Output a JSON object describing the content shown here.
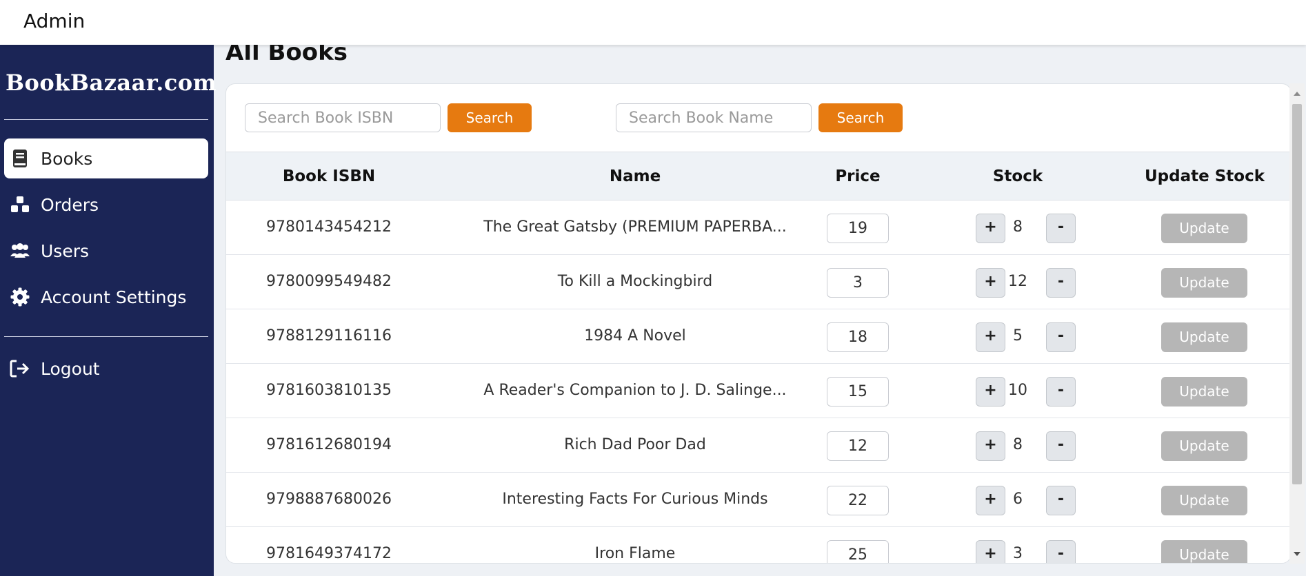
{
  "header": {
    "title": "Admin"
  },
  "sidebar": {
    "brand": "BookBazaar.com",
    "items": [
      {
        "label": "Books",
        "icon": "book-icon",
        "active": true
      },
      {
        "label": "Orders",
        "icon": "orders-icon",
        "active": false
      },
      {
        "label": "Users",
        "icon": "users-icon",
        "active": false
      },
      {
        "label": "Account Settings",
        "icon": "gear-icon",
        "active": false
      }
    ],
    "logout": {
      "label": "Logout",
      "icon": "logout-icon"
    }
  },
  "main": {
    "title": "All Books",
    "search_isbn": {
      "placeholder": "Search Book ISBN",
      "button": "Search"
    },
    "search_name": {
      "placeholder": "Search Book Name",
      "button": "Search"
    },
    "columns": [
      "Book ISBN",
      "Name",
      "Price",
      "Stock",
      "Update Stock"
    ],
    "rows": [
      {
        "isbn": "9780143454212",
        "name": "The Great Gatsby (PREMIUM PAPERBA...",
        "price": "19",
        "stock": "8",
        "plus": "+",
        "minus": "-",
        "update": "Update"
      },
      {
        "isbn": "9780099549482",
        "name": "To Kill a Mockingbird",
        "price": "3",
        "stock": "12",
        "plus": "+",
        "minus": "-",
        "update": "Update"
      },
      {
        "isbn": "9788129116116",
        "name": "1984 A Novel",
        "price": "18",
        "stock": "5",
        "plus": "+",
        "minus": "-",
        "update": "Update"
      },
      {
        "isbn": "9781603810135",
        "name": "A Reader's Companion to J. D. Salinge...",
        "price": "15",
        "stock": "10",
        "plus": "+",
        "minus": "-",
        "update": "Update"
      },
      {
        "isbn": "9781612680194",
        "name": "Rich Dad Poor Dad",
        "price": "12",
        "stock": "8",
        "plus": "+",
        "minus": "-",
        "update": "Update"
      },
      {
        "isbn": "9798887680026",
        "name": "Interesting Facts For Curious Minds",
        "price": "22",
        "stock": "6",
        "plus": "+",
        "minus": "-",
        "update": "Update"
      },
      {
        "isbn": "9781649374172",
        "name": "Iron Flame",
        "price": "25",
        "stock": "3",
        "plus": "+",
        "minus": "-",
        "update": "Update"
      }
    ]
  },
  "colors": {
    "sidebar_bg": "#1b2556",
    "accent": "#e67a10",
    "update_disabled": "#b6b6b6"
  }
}
